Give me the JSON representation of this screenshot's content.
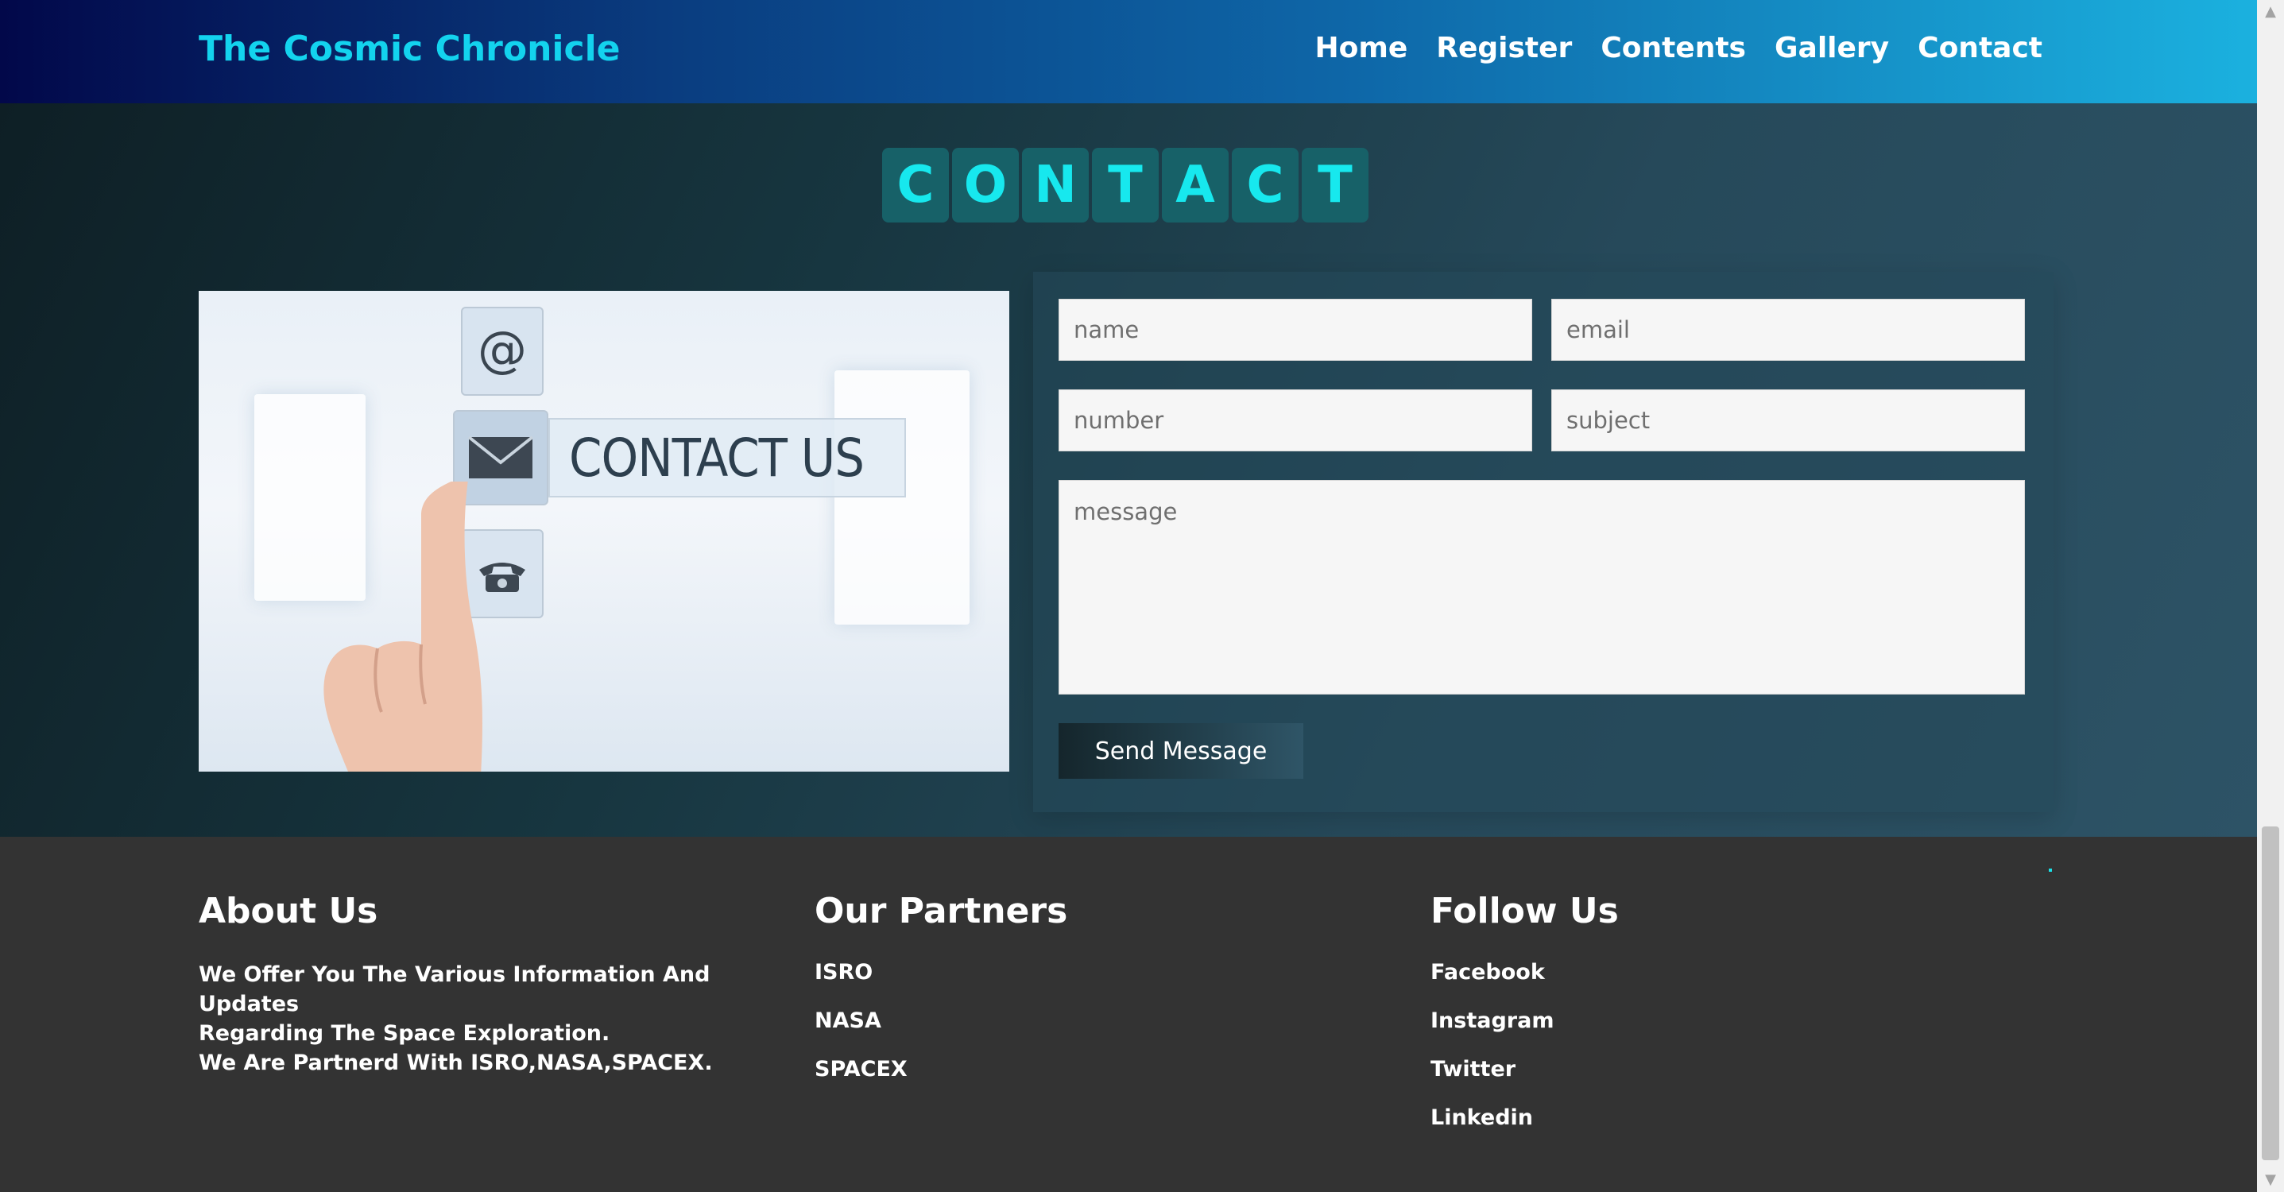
{
  "header": {
    "brand": "The Cosmic Chronicle",
    "nav": [
      "Home",
      "Register",
      "Contents",
      "Gallery",
      "Contact"
    ]
  },
  "contact": {
    "heading_letters": [
      "C",
      "O",
      "N",
      "T",
      "A",
      "C",
      "T"
    ],
    "image_text": "CONTACT US",
    "form": {
      "name_placeholder": "name",
      "email_placeholder": "email",
      "number_placeholder": "number",
      "subject_placeholder": "subject",
      "message_placeholder": "message",
      "send_label": "Send Message"
    }
  },
  "footer": {
    "about": {
      "title": "About Us",
      "line1": "We Offer You The Various Information And Updates",
      "line2": "Regarding The Space Exploration.",
      "line3": "We Are Partnerd With ISRO,NASA,SPACEX."
    },
    "partners": {
      "title": "Our Partners",
      "items": [
        "ISRO",
        "NASA",
        "SPACEX"
      ]
    },
    "follow": {
      "title": "Follow Us",
      "items": [
        "Facebook",
        "Instagram",
        "Twitter",
        "Linkedin"
      ]
    }
  },
  "scrollbar": {
    "up_glyph": "▲",
    "down_glyph": "▼"
  },
  "colors": {
    "brand": "#13d3ee",
    "heading_tile": "#176168",
    "heading_letter": "#17e8ee",
    "footer_bg": "#333333"
  }
}
